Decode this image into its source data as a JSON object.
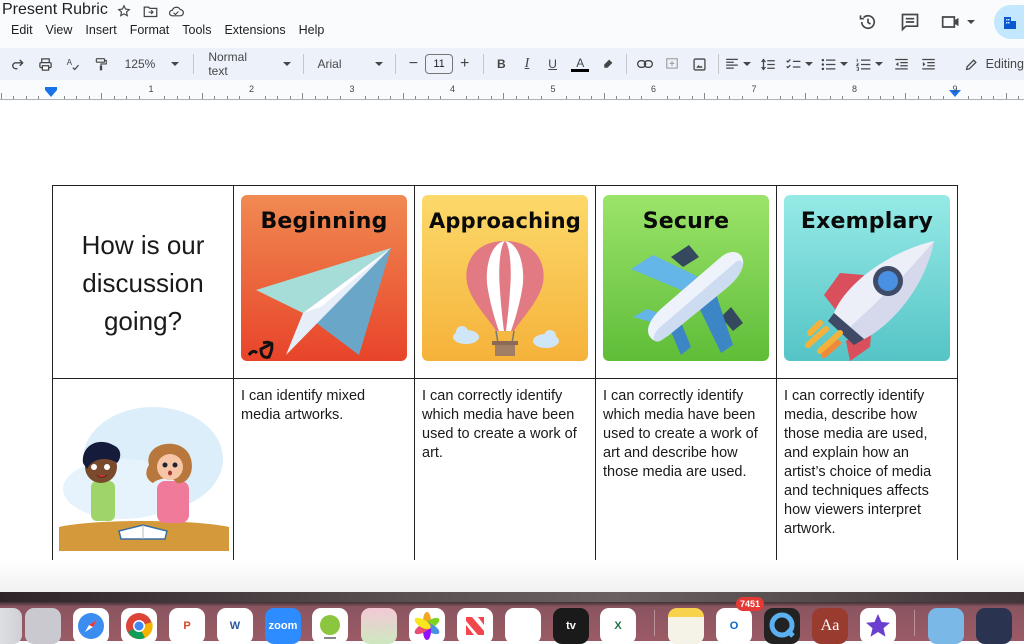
{
  "app": {
    "doc_title": "Present Rubric",
    "menu": [
      "Edit",
      "View",
      "Insert",
      "Format",
      "Tools",
      "Extensions",
      "Help"
    ],
    "title_icons": [
      "star-icon",
      "move-to-folder-icon",
      "cloud-saved-icon"
    ],
    "top_right_icons": [
      "version-history-icon",
      "comments-icon",
      "meet-video-icon",
      "share-button"
    ]
  },
  "toolbar": {
    "zoom": "125%",
    "style": "Normal text",
    "font": "Arial",
    "font_size": "11",
    "decrease": "−",
    "increase": "+",
    "bold": "B",
    "italic": "I",
    "underline": "U",
    "text_color": "A",
    "mode": "Editing",
    "text_color_value": "#000000"
  },
  "ruler": {
    "numbers": [
      "1",
      "2",
      "3",
      "4",
      "5",
      "6",
      "7",
      "8",
      "9"
    ]
  },
  "rubric": {
    "question": "How is our discussion going?",
    "question_lines": [
      "How is our",
      "discussion",
      "going?"
    ],
    "levels": [
      {
        "label": "Beginning",
        "image": "paper-plane",
        "colors": [
          "#f08a52",
          "#e8482a"
        ],
        "description": "I can identify mixed media artworks."
      },
      {
        "label": "Approaching",
        "image": "hot-air-balloon",
        "colors": [
          "#fcd96a",
          "#f6b13a"
        ],
        "description": "I can correctly identify which media have been used to create a work of art."
      },
      {
        "label": "Secure",
        "image": "airplane",
        "colors": [
          "#9be26a",
          "#62c03a"
        ],
        "description": "I can correctly identify which media have been used to create a work of art and describe how those media are used."
      },
      {
        "label": "Exemplary",
        "image": "rocket",
        "colors": [
          "#93e9e5",
          "#56c6c6"
        ],
        "description": "I can correctly identify media, describe how those media are used, and explain how an artist’s choice of media and techniques affects how viewers interpret artwork."
      }
    ]
  },
  "dock": {
    "apps": [
      {
        "name": "Finder"
      },
      {
        "name": "Launchpad"
      },
      {
        "name": "Safari"
      },
      {
        "name": "Chrome"
      },
      {
        "name": "PowerPoint",
        "glyph": "P"
      },
      {
        "name": "Word",
        "glyph": "W"
      },
      {
        "name": "Zoom",
        "glyph": "zoom"
      },
      {
        "name": "Geography App"
      },
      {
        "name": "Maps"
      },
      {
        "name": "Photos"
      },
      {
        "name": "News"
      },
      {
        "name": "Freeform"
      },
      {
        "name": "Apple TV",
        "glyph": "tv"
      },
      {
        "name": "Excel",
        "glyph": "X"
      },
      {
        "name": "Notes"
      },
      {
        "name": "Outlook",
        "glyph": "O",
        "badge": "7451"
      },
      {
        "name": "QuickTime"
      },
      {
        "name": "Dictionary",
        "glyph": "Aa"
      },
      {
        "name": "iMovie"
      },
      {
        "name": "Applications Folder"
      },
      {
        "name": "Network Radar"
      }
    ]
  }
}
